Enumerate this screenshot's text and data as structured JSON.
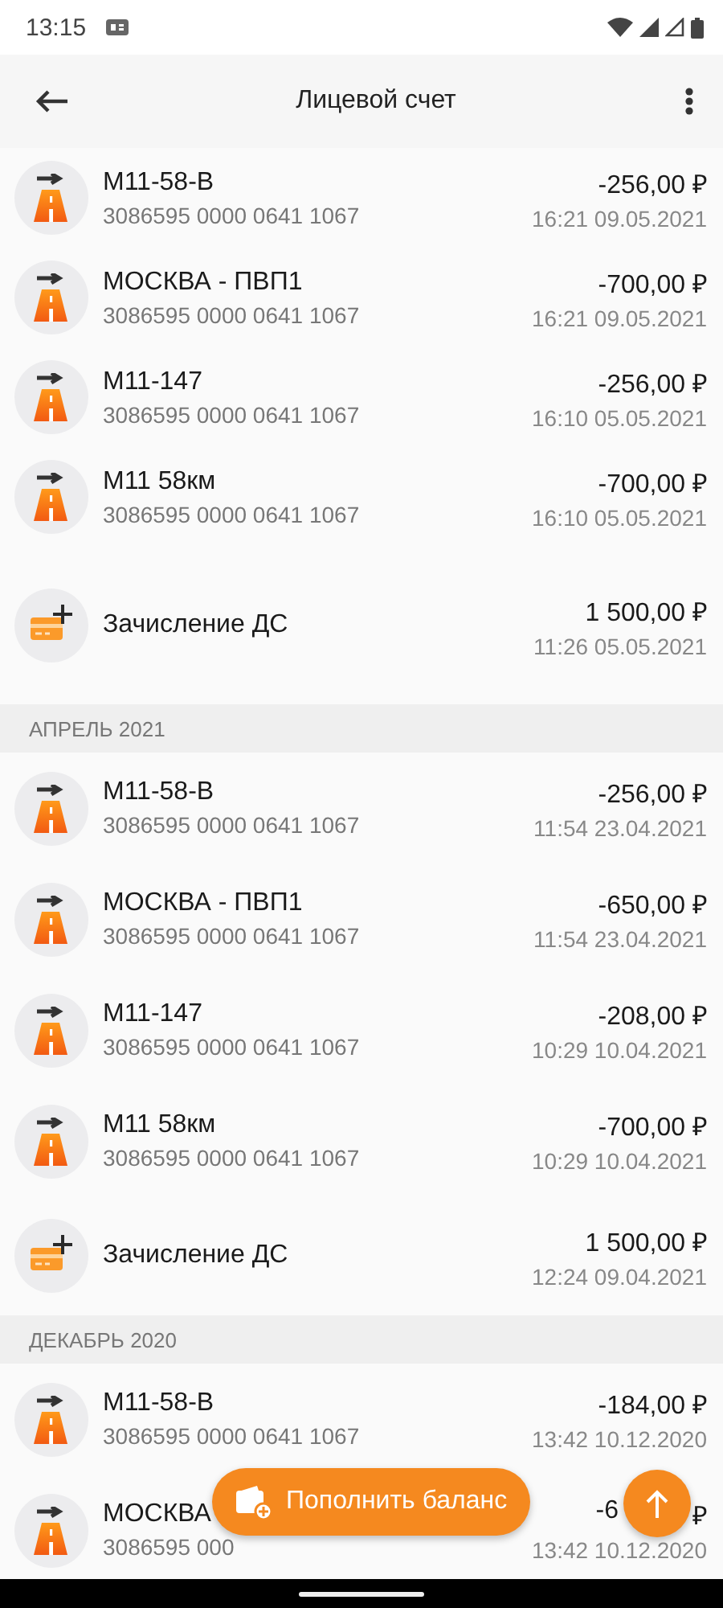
{
  "status_bar": {
    "time": "13:15"
  },
  "app_bar": {
    "title": "Лицевой счет"
  },
  "groups": [
    {
      "rows": [
        {
          "kind": "toll",
          "title": "М11-58-В",
          "number": "3086595 0000 0641 1067",
          "amount": "-256,00 ₽",
          "time": "16:21 09.05.2021"
        },
        {
          "kind": "toll",
          "title": "МОСКВА - ПВП1",
          "number": "3086595 0000 0641 1067",
          "amount": "-700,00 ₽",
          "time": "16:21 09.05.2021"
        },
        {
          "kind": "toll",
          "title": "М11-147",
          "number": "3086595 0000 0641 1067",
          "amount": "-256,00 ₽",
          "time": "16:10 05.05.2021"
        },
        {
          "kind": "toll",
          "title": "М11 58км",
          "number": "3086595 0000 0641 1067",
          "amount": "-700,00 ₽",
          "time": "16:10 05.05.2021"
        },
        {
          "kind": "credit",
          "title": "Зачисление ДС",
          "amount": "1 500,00 ₽",
          "time": "11:26 05.05.2021"
        }
      ]
    },
    {
      "header": "АПРЕЛЬ 2021",
      "rows": [
        {
          "kind": "toll",
          "title": "М11-58-В",
          "number": "3086595 0000 0641 1067",
          "amount": "-256,00 ₽",
          "time": "11:54 23.04.2021"
        },
        {
          "kind": "toll",
          "title": "МОСКВА - ПВП1",
          "number": "3086595 0000 0641 1067",
          "amount": "-650,00 ₽",
          "time": "11:54 23.04.2021"
        },
        {
          "kind": "toll",
          "title": "М11-147",
          "number": "3086595 0000 0641 1067",
          "amount": "-208,00 ₽",
          "time": "10:29 10.04.2021"
        },
        {
          "kind": "toll",
          "title": "М11 58км",
          "number": "3086595 0000 0641 1067",
          "amount": "-700,00 ₽",
          "time": "10:29 10.04.2021"
        },
        {
          "kind": "credit",
          "title": "Зачисление ДС",
          "amount": "1 500,00 ₽",
          "time": "12:24 09.04.2021"
        }
      ]
    },
    {
      "header": "ДЕКАБРЬ 2020",
      "rows": [
        {
          "kind": "toll",
          "title": "М11-58-В",
          "number": "3086595 0000 0641 1067",
          "amount": "-184,00 ₽",
          "time": "13:42 10.12.2020"
        },
        {
          "kind": "toll",
          "title": "МОСКВА",
          "number": "3086595 000",
          "amount_parts": [
            "-6",
            "₽"
          ],
          "time": "13:42 10.12.2020"
        }
      ]
    }
  ],
  "topup_button": {
    "label": "Пополнить баланс"
  }
}
